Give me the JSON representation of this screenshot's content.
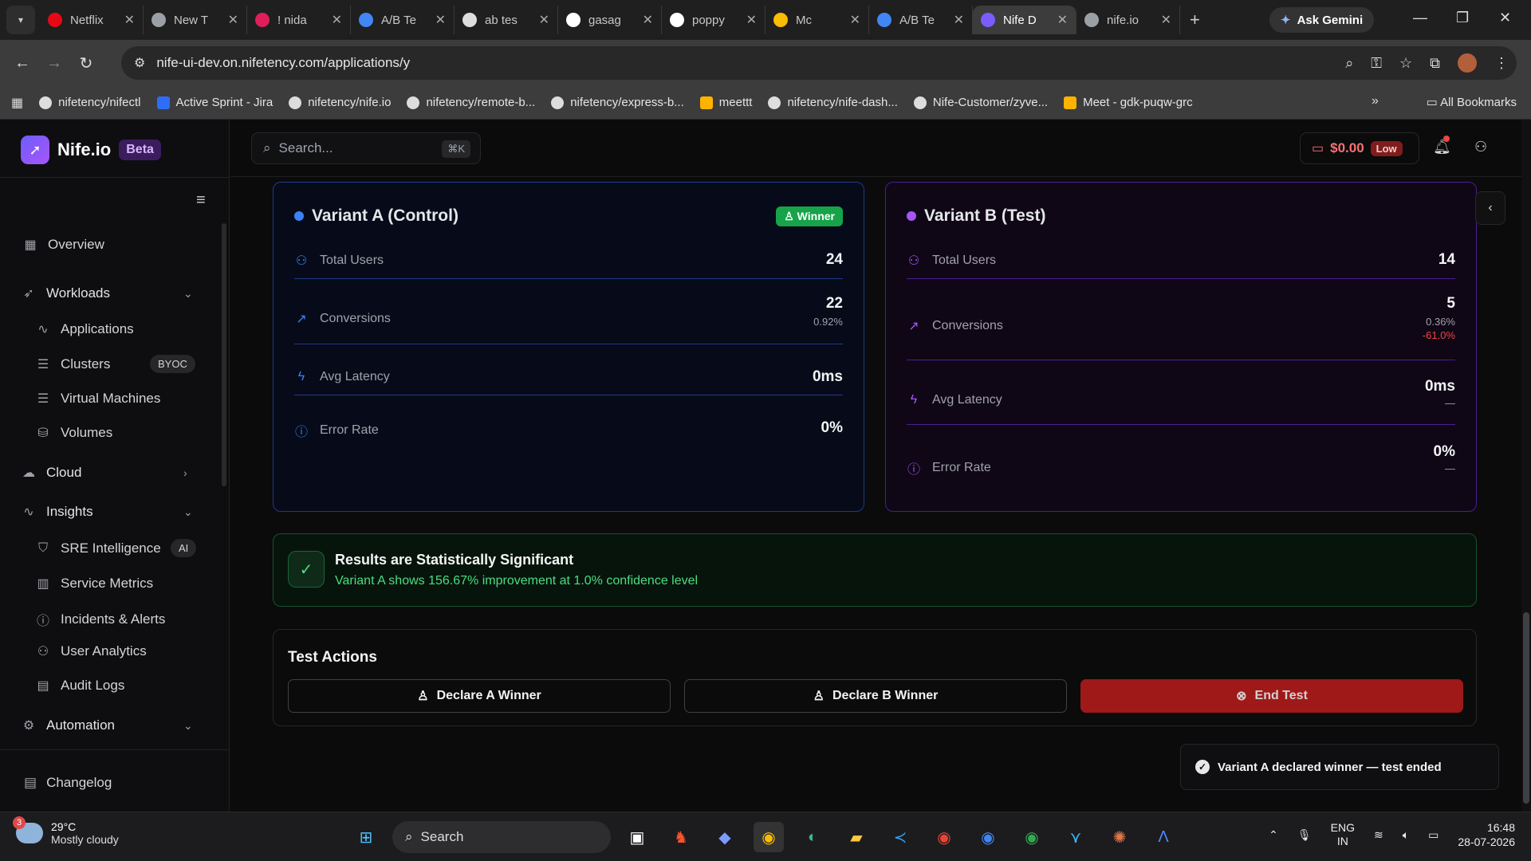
{
  "browser": {
    "tabs": [
      {
        "title": "Netflix",
        "icon": "netflix-icon",
        "color": "#e50914"
      },
      {
        "title": "New T",
        "icon": "chrome-icon",
        "color": "#9aa0a6"
      },
      {
        "title": "! nida",
        "icon": "slack-icon",
        "color": "#e01e5a"
      },
      {
        "title": "A/B Te",
        "icon": "nife-icon",
        "color": "#4285f4"
      },
      {
        "title": "ab tes",
        "icon": "github-icon",
        "color": "#dddddd"
      },
      {
        "title": "gasag",
        "icon": "google-icon",
        "color": "#ffffff"
      },
      {
        "title": "poppy",
        "icon": "google-icon",
        "color": "#ffffff"
      },
      {
        "title": "Mc",
        "icon": "meet-icon",
        "color": "#fbbc04"
      },
      {
        "title": "A/B Te",
        "icon": "nife-icon",
        "color": "#4285f4"
      },
      {
        "title": "Nife D",
        "icon": "nife-logo-icon",
        "color": "#7c5cff"
      },
      {
        "title": "nife.io",
        "icon": "globe-icon",
        "color": "#9aa0a6"
      }
    ],
    "ask_gemini": "Ask Gemini",
    "url": "nife-ui-dev.on.nifetency.com/applications/y",
    "bookmarks": [
      {
        "label": "nifetency/nifectl",
        "icon": "github-icon"
      },
      {
        "label": "Active Sprint - Jira",
        "icon": "jira-icon"
      },
      {
        "label": "nifetency/nife.io",
        "icon": "github-icon"
      },
      {
        "label": "nifetency/remote-b...",
        "icon": "github-icon"
      },
      {
        "label": "nifetency/express-b...",
        "icon": "github-icon"
      },
      {
        "label": "meettt",
        "icon": "meet-icon"
      },
      {
        "label": "nifetency/nife-dash...",
        "icon": "github-icon"
      },
      {
        "label": "Nife-Customer/zyve...",
        "icon": "github-icon"
      },
      {
        "label": "Meet - gdk-puqw-grc",
        "icon": "meet-icon"
      }
    ],
    "all_bookmarks": "All Bookmarks"
  },
  "app": {
    "brand": "Nife.io",
    "beta": "Beta",
    "search_placeholder": "Search...",
    "search_kbd": "⌘K",
    "credit": "$0.00",
    "credit_status": "Low",
    "nav": {
      "overview": "Overview",
      "workloads": "Workloads",
      "applications": "Applications",
      "clusters": "Clusters",
      "clusters_badge": "BYOC",
      "virtual_machines": "Virtual Machines",
      "volumes": "Volumes",
      "cloud": "Cloud",
      "insights": "Insights",
      "sre": "SRE Intelligence",
      "sre_badge": "AI",
      "service_metrics": "Service Metrics",
      "incidents": "Incidents & Alerts",
      "user_analytics": "User Analytics",
      "audit_logs": "Audit Logs",
      "automation": "Automation",
      "changelog": "Changelog"
    }
  },
  "variant_a": {
    "title": "Variant A (Control)",
    "winner_badge": "Winner",
    "color": "#3b82f6",
    "total_users_label": "Total Users",
    "total_users": "24",
    "conversions_label": "Conversions",
    "conversions": "22",
    "conversion_rate": "0.92%",
    "latency_label": "Avg Latency",
    "latency": "0ms",
    "error_label": "Error Rate",
    "error_rate": "0%"
  },
  "variant_b": {
    "title": "Variant B (Test)",
    "color": "#a855f7",
    "total_users_label": "Total Users",
    "total_users": "14",
    "conversions_label": "Conversions",
    "conversions": "5",
    "conversion_rate": "0.36%",
    "conversion_delta": "-61.0%",
    "latency_label": "Avg Latency",
    "latency": "0ms",
    "latency_delta": "—",
    "error_label": "Error Rate",
    "error_rate": "0%",
    "error_delta": "—"
  },
  "significance": {
    "title": "Results are Statistically Significant",
    "detail": "Variant A shows 156.67% improvement at 1.0% confidence level"
  },
  "test_actions": {
    "title": "Test Actions",
    "declare_a": "Declare A Winner",
    "declare_b": "Declare B Winner",
    "end_test": "End Test"
  },
  "toast": "Variant A declared winner — test ended",
  "taskbar": {
    "notif_count": "3",
    "temperature": "29°C",
    "condition": "Mostly cloudy",
    "search": "Search",
    "lang_1": "ENG",
    "lang_2": "IN",
    "time": "16:48",
    "date": "28-07-2026"
  }
}
